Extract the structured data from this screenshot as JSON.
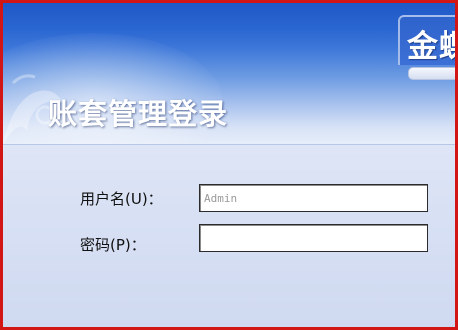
{
  "brand": {
    "text": "金蝶"
  },
  "title": "账套管理登录",
  "form": {
    "username_label": "用户名(U)：",
    "username_value": "Admin",
    "password_label": "密码(P)：",
    "password_value": ""
  },
  "colors": {
    "frame_border": "#d21515",
    "banner_blue": "#2a66d1",
    "title_text": "#ffffff",
    "field_text": "#9a9a9a"
  },
  "icons": [
    "decorative-ornament"
  ]
}
